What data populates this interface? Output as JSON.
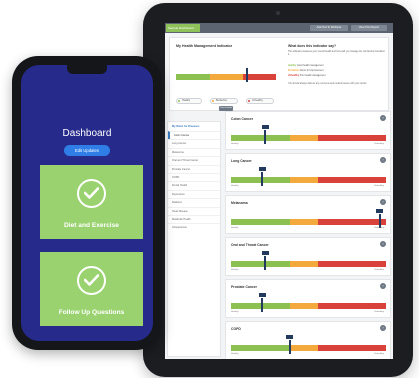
{
  "tablet": {
    "topbar": {
      "home_tab": "Sample Dashboard",
      "nav_buttons": [
        "Add Test To Wellness",
        "View Print Report"
      ]
    },
    "health_indicator": {
      "title": "My Health Management Indicator",
      "pills": [
        {
          "label": "Healthy",
          "color": "#8cc152"
        },
        {
          "label": "Borderline",
          "color": "#f3a93b"
        },
        {
          "label": "Unhealthy",
          "color": "#d9423a"
        }
      ],
      "details_button": "View Details",
      "right_title": "What does this indicator say?",
      "right_text": "This indicator assesses your overall health and how well you manage the risk factors that affect it.",
      "legend": [
        {
          "key": "Healthy",
          "text": "Good health management"
        },
        {
          "key": "Borderline",
          "text": "Room for improvement"
        },
        {
          "key": "Unhealthy",
          "text": "Poor health management"
        }
      ],
      "footer_text": "You should always discuss any concerns and medical issues with your doctor."
    },
    "side_menu": {
      "heading": "My Risks for Diseases",
      "items": [
        "Colon Cancer",
        "Lung Cancer",
        "Melanoma",
        "Oral and Throat Cancer",
        "Prostate Cancer",
        "COPD",
        "Dental Health",
        "Depression",
        "Diabetes",
        "Heart Disease",
        "Metabolic Health",
        "Osteoporosis"
      ]
    },
    "risk_cards": [
      {
        "title": "Colon Cancer",
        "level": 0.22,
        "low_label": "Healthy",
        "high_label": "Unhealthy"
      },
      {
        "title": "Lung Cancer",
        "level": 0.2,
        "low_label": "Healthy",
        "high_label": "Unhealthy"
      },
      {
        "title": "Melanoma",
        "level": 0.96,
        "low_label": "Healthy",
        "high_label": "Unhealthy"
      },
      {
        "title": "Oral and Throat Cancer",
        "level": 0.22,
        "low_label": "Healthy",
        "high_label": "Unhealthy"
      },
      {
        "title": "Prostate Cancer",
        "level": 0.2,
        "low_label": "Healthy",
        "high_label": "Unhealthy"
      },
      {
        "title": "COPD",
        "level": 0.38,
        "low_label": "Healthy",
        "high_label": "Unhealthy"
      }
    ]
  },
  "phone": {
    "dashboard_title": "Dashboard",
    "edit_button": "Edit Updates",
    "tiles": [
      {
        "label": "Diet and Exercise",
        "icon": "check-circle-icon"
      },
      {
        "label": "Follow Up Questions",
        "icon": "check-circle-icon"
      }
    ]
  }
}
